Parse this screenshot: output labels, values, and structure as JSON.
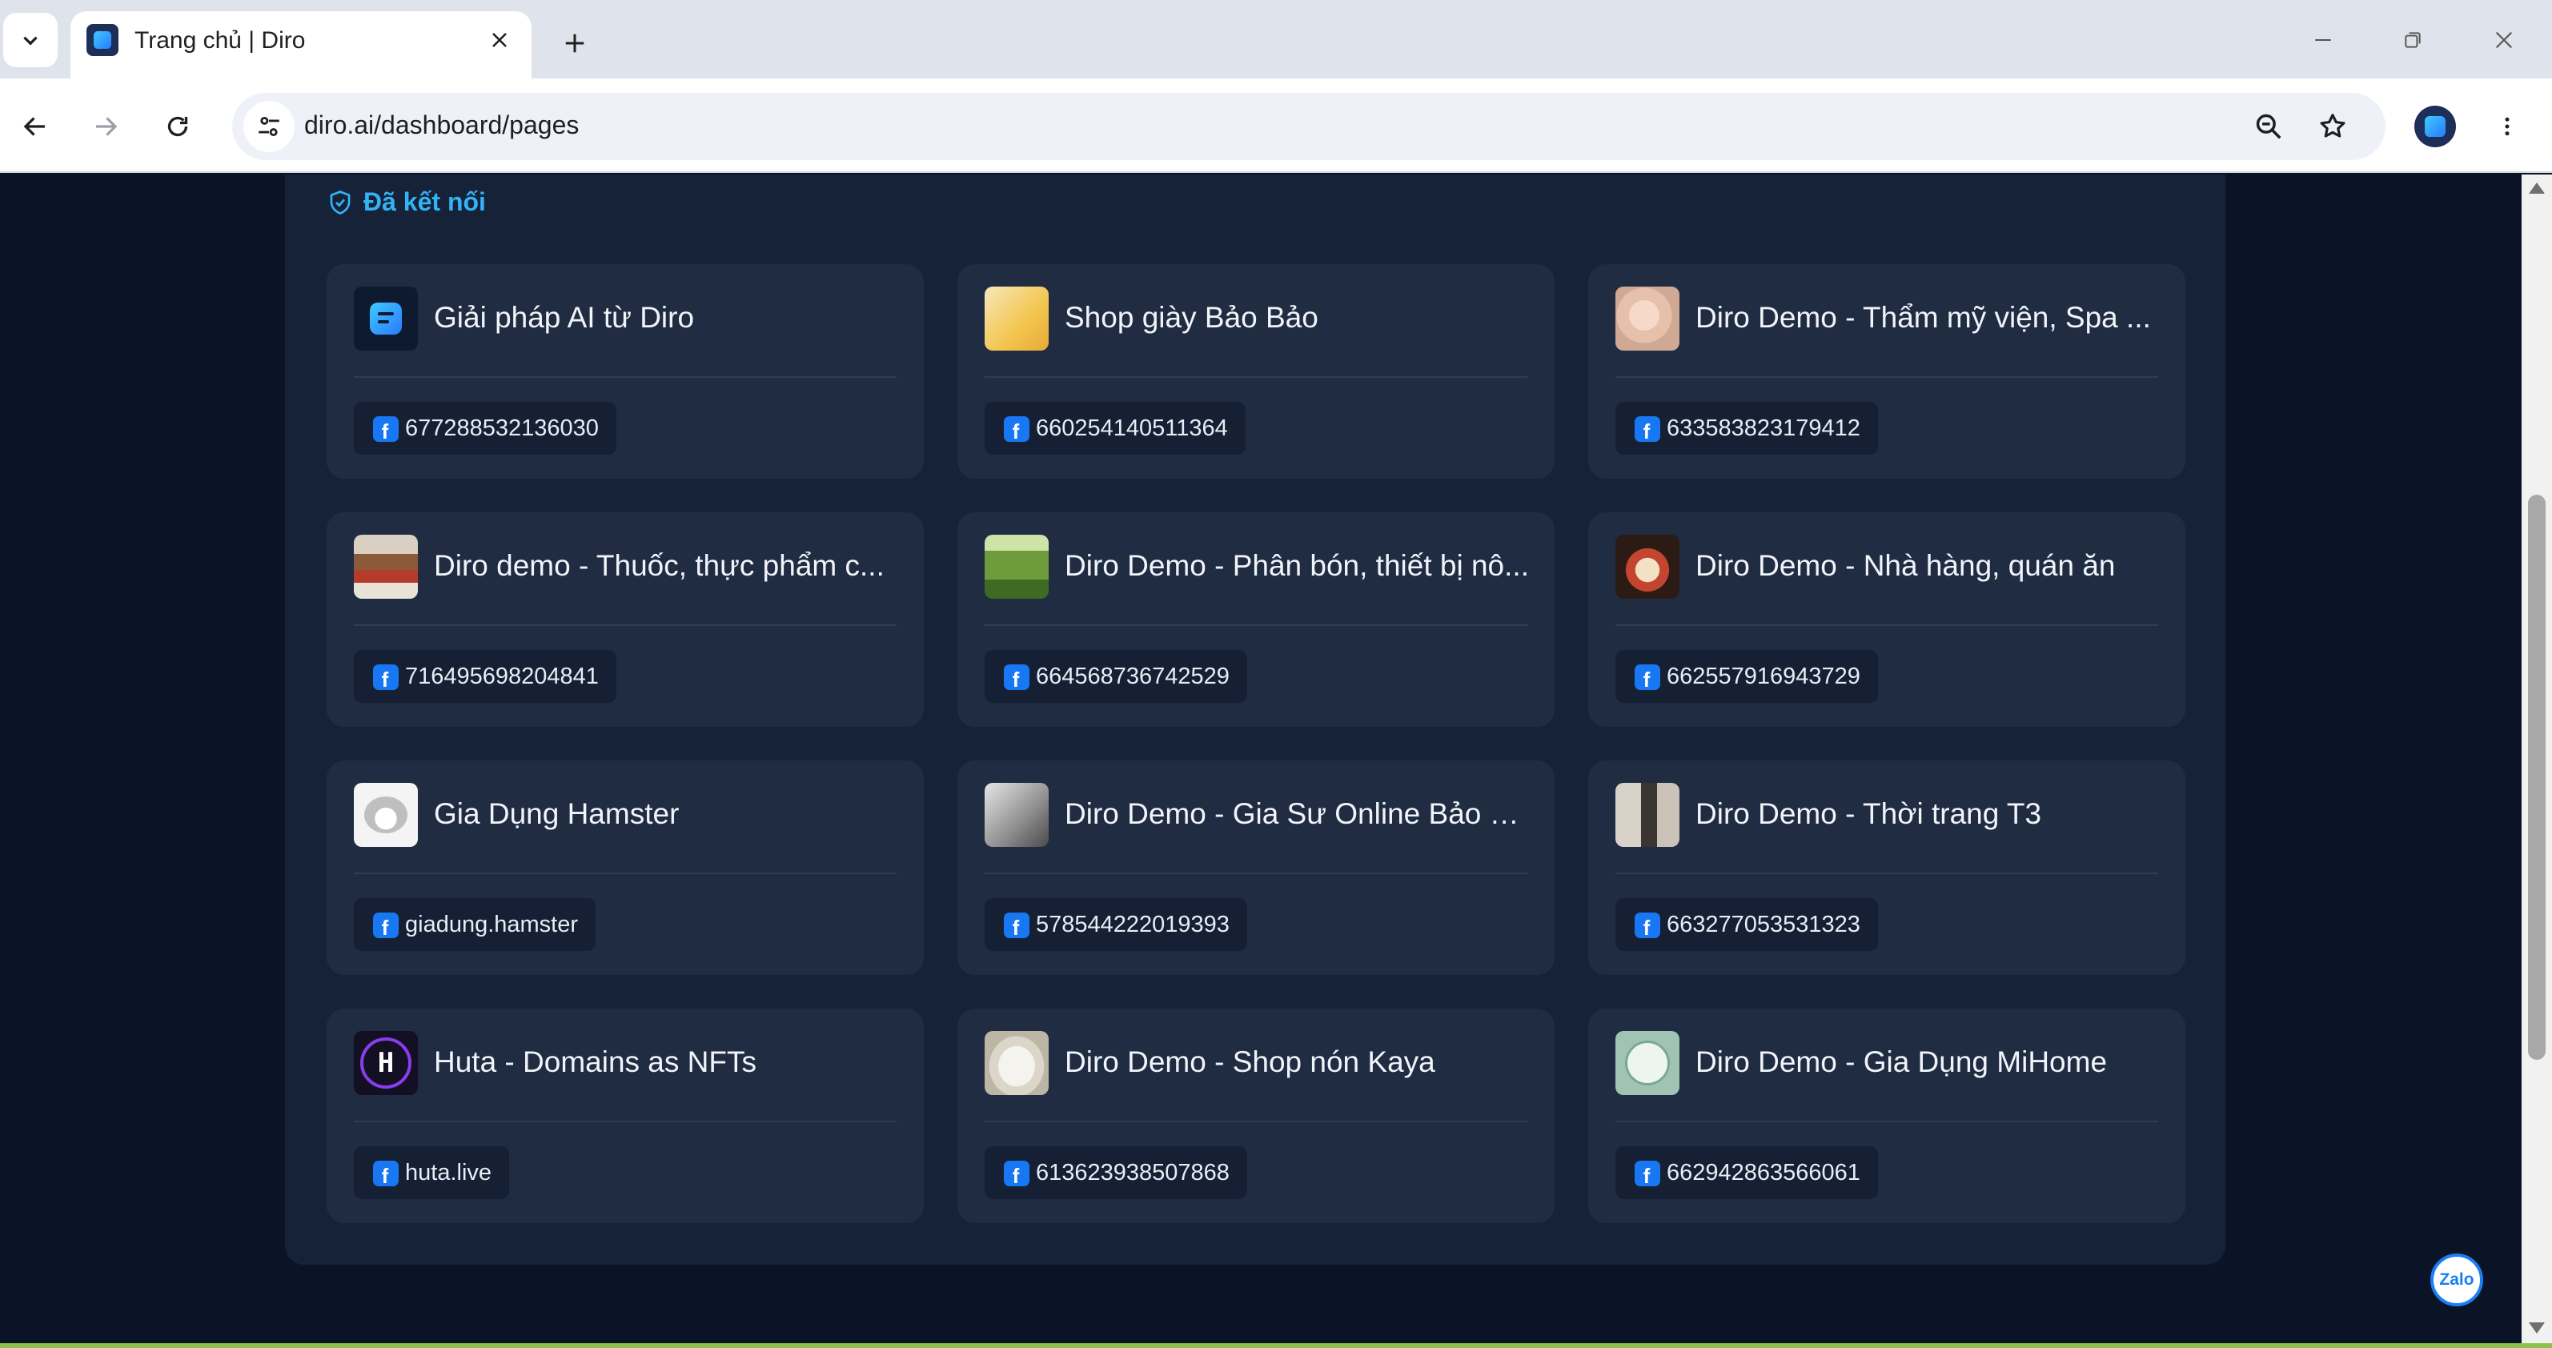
{
  "browser": {
    "tab_title": "Trang chủ | Diro",
    "url": "diro.ai/dashboard/pages"
  },
  "page": {
    "connected_label": "Đã kết nối",
    "pages": [
      {
        "name": "Giải pháp AI từ Diro",
        "id": "677288532136030",
        "thumb": "diro-logo"
      },
      {
        "name": "Shop giày Bảo Bảo",
        "id": "660254140511364",
        "thumb": "shoes"
      },
      {
        "name": "Diro Demo - Thẩm mỹ viện, Spa ...",
        "id": "633583823179412",
        "thumb": "spa"
      },
      {
        "name": "Diro demo - Thuốc, thực phẩm c...",
        "id": "716495698204841",
        "thumb": "pharmacy"
      },
      {
        "name": "Diro Demo - Phân bón, thiết bị nô...",
        "id": "664568736742529",
        "thumb": "farm"
      },
      {
        "name": "Diro Demo - Nhà hàng, quán ăn",
        "id": "662557916943729",
        "thumb": "restaurant"
      },
      {
        "name": "Gia Dụng Hamster",
        "id": "giadung.hamster",
        "thumb": "hamster"
      },
      {
        "name": "Diro Demo - Gia Sư Online Bảo C...",
        "id": "578544222019393",
        "thumb": "tutor"
      },
      {
        "name": "Diro Demo - Thời trang T3",
        "id": "663277053531323",
        "thumb": "fashion"
      },
      {
        "name": "Huta - Domains as NFTs",
        "id": "huta.live",
        "thumb": "huta"
      },
      {
        "name": "Diro Demo - Shop nón Kaya",
        "id": "613623938507868",
        "thumb": "hat"
      },
      {
        "name": "Diro Demo - Gia Dụng MiHome",
        "id": "662942863566061",
        "thumb": "mihome"
      }
    ]
  },
  "chat_widget": {
    "label": "Zalo"
  },
  "colors": {
    "accent": "#33b3f5",
    "facebook": "#1877f2",
    "page_bg": "#0b1426",
    "card_bg": "#1f2c42"
  }
}
